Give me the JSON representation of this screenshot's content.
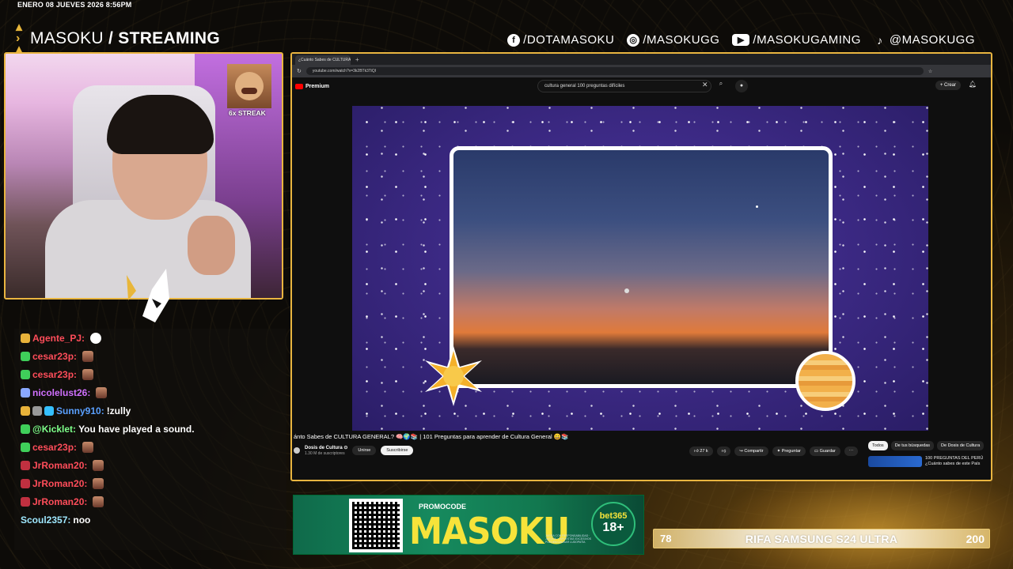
{
  "overlay": {
    "datetime": "ENERO 08 JUEVES 2026 8:56PM",
    "brand_name": "MASOKU",
    "brand_suffix": "/ STREAMING",
    "socials": [
      {
        "icon": "facebook-icon",
        "handle": "/DOTAMASOKU"
      },
      {
        "icon": "instagram-icon",
        "handle": "/MASOKUGG"
      },
      {
        "icon": "youtube-icon",
        "handle": "/MASOKUGAMING"
      },
      {
        "icon": "tiktok-icon",
        "handle": "@MASOKUGG"
      }
    ],
    "streak": "6x STREAK"
  },
  "chat": [
    {
      "user": "Agente_PJ:",
      "color": "#ff4d5a",
      "badges": [
        "#e8b23a"
      ],
      "message": "",
      "emote": "white"
    },
    {
      "user": "cesar23p:",
      "color": "#ff4d5a",
      "badges": [
        "#3fcf5a"
      ],
      "message": "",
      "emote": "face"
    },
    {
      "user": "cesar23p:",
      "color": "#ff4d5a",
      "badges": [
        "#3fcf5a"
      ],
      "message": "",
      "emote": "face"
    },
    {
      "user": "nicolelust26:",
      "color": "#d070ff",
      "badges": [
        "#8aa8ff"
      ],
      "message": "",
      "emote": "face"
    },
    {
      "user": "Sunny910:",
      "color": "#5aa0ff",
      "badges": [
        "#e8b23a",
        "#999999",
        "#35c0ff"
      ],
      "message": "!zully",
      "emote": ""
    },
    {
      "user": "@Kicklet:",
      "color": "#7dff8a",
      "badges": [
        "#3fcf5a"
      ],
      "message": "You have played a sound.",
      "emote": ""
    },
    {
      "user": "cesar23p:",
      "color": "#ff4d5a",
      "badges": [
        "#3fcf5a"
      ],
      "message": "",
      "emote": "face"
    },
    {
      "user": "JrRoman20:",
      "color": "#ff4d5a",
      "badges": [
        "#c03040"
      ],
      "message": "",
      "emote": "face"
    },
    {
      "user": "JrRoman20:",
      "color": "#ff4d5a",
      "badges": [
        "#c03040"
      ],
      "message": "",
      "emote": "face"
    },
    {
      "user": "JrRoman20:",
      "color": "#ff4d5a",
      "badges": [
        "#c03040"
      ],
      "message": "",
      "emote": "face"
    },
    {
      "user": "Scoul2357:",
      "color": "#9fe8ff",
      "badges": [],
      "message": "noo",
      "emote": ""
    }
  ],
  "browser": {
    "tab_title": "¿Cuánto Sabes de CULTURA G",
    "url": "youtube.com/watch?v=3k2BTk3TiQI",
    "yt_premium": "Premium",
    "search_query": "cultura general 100 preguntas difíciles",
    "create_label": "Crear",
    "video_title": "ánto Sabes de CULTURA GENERAL? 🧠🌍📚 | 101 Preguntas para aprender de Cultura General 😄📚",
    "channel_name": "Dosis de Cultura ⊙",
    "channel_subs": "1.30 M de suscriptores",
    "join_label": "Unirse",
    "subscribed_label": "Suscribirse",
    "likes": "27 k",
    "share_label": "Compartir",
    "ask_label": "Preguntar",
    "save_label": "Guardar",
    "chips": [
      "Todos",
      "De tus búsquedas",
      "De Dosis de Cultura"
    ],
    "suggested_title": "100 PREGUNTAS DEL PERÚ",
    "suggested_sub": "¿Cuánto sabes de este País"
  },
  "ad": {
    "promo_label": "PROMOCODE",
    "code": "MASOKU",
    "brand": "bet365",
    "age": "18+",
    "legal": "JUEGA CON RESPONSABILIDAD · JUEGOS Y APUESTAS EXCESIVOS PUEDEN CAUSAR LUDOPATÍA"
  },
  "raffle": {
    "current": "78",
    "title": "RIFA SAMSUNG S24 ULTRA",
    "goal": "200",
    "progress_fraction": 0.39
  }
}
